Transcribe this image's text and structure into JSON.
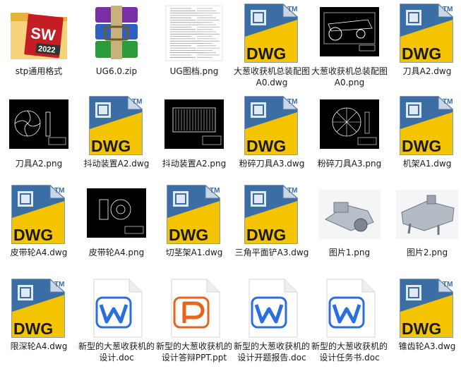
{
  "files": [
    {
      "id": "stp",
      "name": "stp通用格式",
      "icon": "solidworks-folder"
    },
    {
      "id": "ug60zip",
      "name": "UG6.0.zip",
      "icon": "winrar-archive"
    },
    {
      "id": "ugpng",
      "name": "UG图档.png",
      "icon": "document-thumbnail"
    },
    {
      "id": "dzA0dwg",
      "name": "大葱收获机总装配图A0.dwg",
      "icon": "dwg-file"
    },
    {
      "id": "dzA0png",
      "name": "大葱收获机总装配图A0.png",
      "icon": "cad-assembly-thumbnail"
    },
    {
      "id": "djA2dwg",
      "name": "刀具A2.dwg",
      "icon": "dwg-file"
    },
    {
      "id": "djA2png",
      "name": "刀具A2.png",
      "icon": "cad-blade-thumbnail"
    },
    {
      "id": "ddA2dwg",
      "name": "抖动装置A2.dwg",
      "icon": "dwg-file"
    },
    {
      "id": "ddA2png",
      "name": "抖动装置A2.png",
      "icon": "cad-grid-thumbnail"
    },
    {
      "id": "fsA3dwg",
      "name": "粉碎刀具A3.dwg",
      "icon": "dwg-file"
    },
    {
      "id": "fsA3png",
      "name": "粉碎刀具A3.png",
      "icon": "cad-wheel-thumbnail"
    },
    {
      "id": "jjA1dwg",
      "name": "机架A1.dwg",
      "icon": "dwg-file"
    },
    {
      "id": "pdA4dwg",
      "name": "皮带轮A4.dwg",
      "icon": "dwg-file"
    },
    {
      "id": "pdA4png",
      "name": "皮带轮A4.png",
      "icon": "cad-pulley-thumbnail"
    },
    {
      "id": "qjA1dwg",
      "name": "切茎架A1.dwg",
      "icon": "dwg-file"
    },
    {
      "id": "sjA3dwg",
      "name": "三角平面铲A3.dwg",
      "icon": "dwg-file"
    },
    {
      "id": "tp1",
      "name": "图片1.png",
      "icon": "3d-model-thumbnail"
    },
    {
      "id": "tp2",
      "name": "图片2.png",
      "icon": "3d-model-thumbnail"
    },
    {
      "id": "xsA4dwg",
      "name": "限深轮A4.dwg",
      "icon": "dwg-file"
    },
    {
      "id": "doc1",
      "name": "新型的大葱收获机的设计.doc",
      "icon": "wps-writer-doc"
    },
    {
      "id": "ppt1",
      "name": "新型的大葱收获机的设计答辩PPT.ppt",
      "icon": "wps-presentation"
    },
    {
      "id": "doc2",
      "name": "新型的大葱收获机的设计开题报告.doc",
      "icon": "wps-writer-doc"
    },
    {
      "id": "doc3",
      "name": "新型的大葱收获机的设计任务书.doc",
      "icon": "wps-writer-doc"
    },
    {
      "id": "zcA3dwg",
      "name": "锥齿轮A3.dwg",
      "icon": "dwg-file"
    }
  ],
  "icon_text": {
    "dwg": "DWG",
    "tm": "TM",
    "sw": "SW",
    "sw_year": "2022"
  },
  "colors": {
    "dwg_yellow": "#f5c400",
    "dwg_blue": "#3a6ea5",
    "wps_blue": "#2a6fe0",
    "wps_orange": "#e8641c",
    "folder": "#f3c453"
  }
}
